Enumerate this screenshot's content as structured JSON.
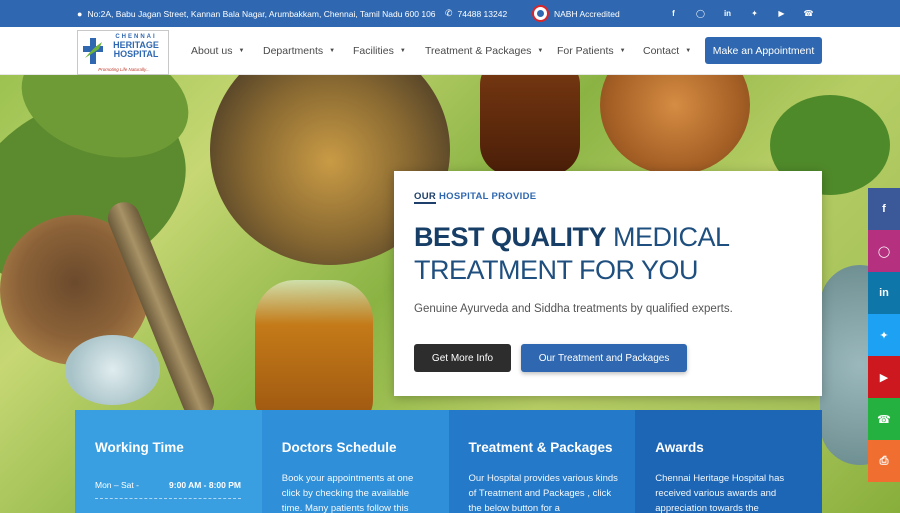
{
  "topbar": {
    "address": "No:2A, Babu Jagan Street, Kannan Bala Nagar, Arumbakkam, Chennai, Tamil Nadu 600 106",
    "phone": "74488 13242",
    "accreditation": "NABH Accredited",
    "social": [
      "facebook-icon",
      "instagram-icon",
      "linkedin-icon",
      "twitter-icon",
      "youtube-icon",
      "whatsapp-icon"
    ]
  },
  "logo": {
    "line1": "CHENNAI",
    "line2": "HERITAGE",
    "line3": "HOSPITAL",
    "tagline": "Promoting Life Naturally..."
  },
  "nav": {
    "items": [
      {
        "label": "About us"
      },
      {
        "label": "Departments"
      },
      {
        "label": "Facilities"
      },
      {
        "label": "Treatment & Packages"
      },
      {
        "label": "For Patients"
      },
      {
        "label": "Contact"
      }
    ],
    "cta": "Make an Appointment"
  },
  "hero": {
    "eyebrow_highlight": "OUR",
    "eyebrow_rest": "HOSPITAL PROVIDE",
    "headline_bold": "BEST QUALITY",
    "headline_rest": "MEDICAL TREATMENT FOR YOU",
    "subtext": "Genuine Ayurveda and Siddha treatments by qualified experts.",
    "btn_primary": "Get More Info",
    "btn_secondary": "Our Treatment and Packages"
  },
  "side_social": [
    {
      "icon": "facebook-icon",
      "color": "#3b5998"
    },
    {
      "icon": "instagram-icon",
      "color": "#b5307f"
    },
    {
      "icon": "linkedin-icon",
      "color": "#0e76a8"
    },
    {
      "icon": "twitter-icon",
      "color": "#1da1f2"
    },
    {
      "icon": "youtube-icon",
      "color": "#cc181e"
    },
    {
      "icon": "whatsapp-icon",
      "color": "#25b140"
    },
    {
      "icon": "print-icon",
      "color": "#f06e2f"
    }
  ],
  "cards": [
    {
      "title": "Working Time",
      "color": "#3a9fe0",
      "row_label": "Mon – Sat  -",
      "row_value": "9:00 AM - 8:00 PM"
    },
    {
      "title": "Doctors Schedule",
      "color": "#2f8fd8",
      "text": "Book your appointments at one click by checking the available time. Many patients follow this"
    },
    {
      "title": "Treatment & Packages",
      "color": "#2479c8",
      "text": "Our Hospital provides various kinds of Treatment and Packages , click the below button for a"
    },
    {
      "title": "Awards",
      "color": "#1d66b5",
      "text": "Chennai Heritage Hospital has received various awards and appreciation towards the"
    }
  ],
  "colors": {
    "brand": "#2f68b0",
    "dark_button": "#2d2d2d",
    "heading": "#1f4f7f"
  }
}
